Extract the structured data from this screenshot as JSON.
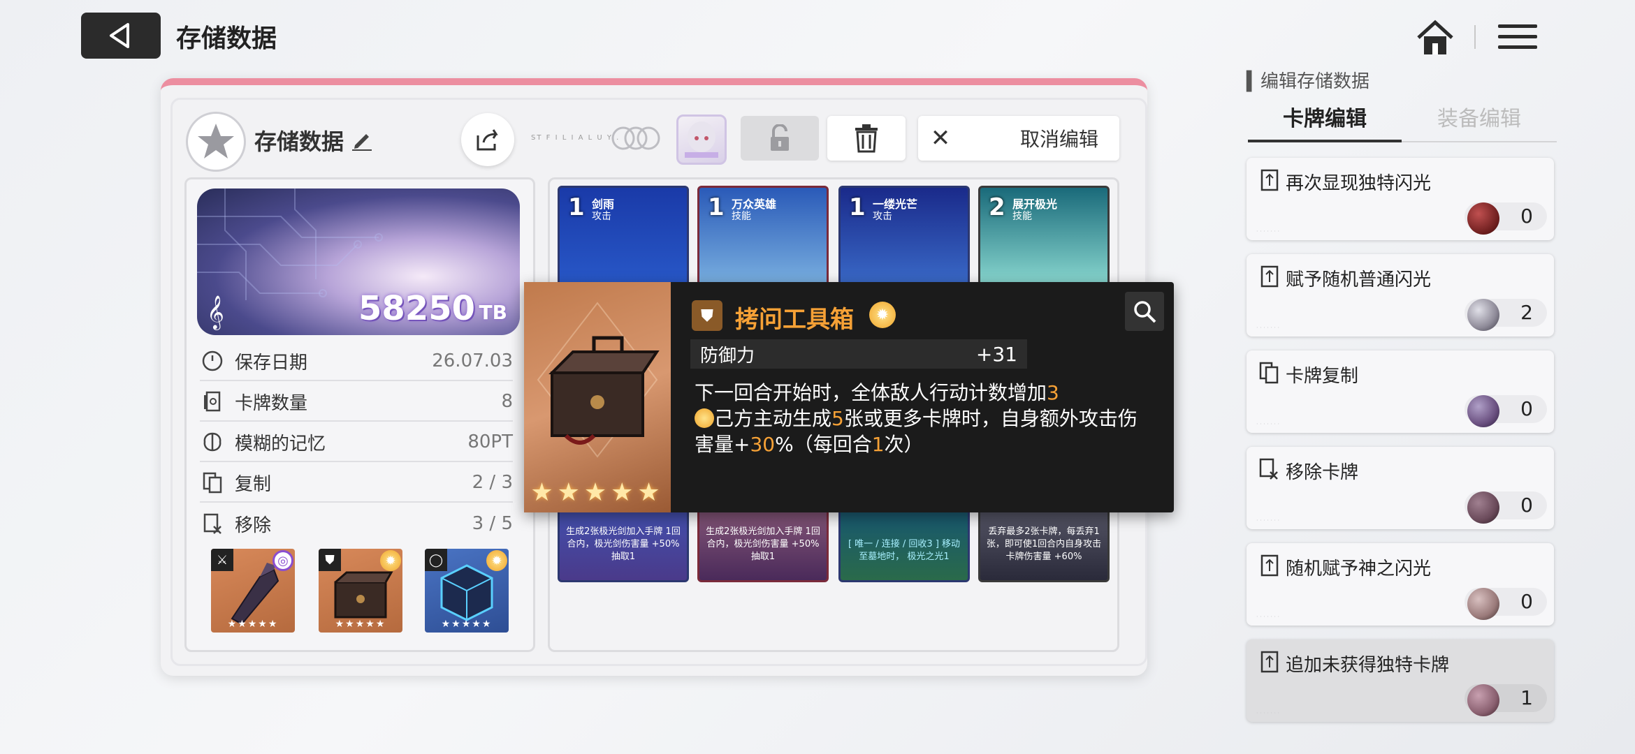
{
  "header": {
    "title": "存储数据"
  },
  "panel": {
    "data_name": "存储数据",
    "tiny_text": "ST F I L I A L U Y .",
    "cancel_label": "取消编辑"
  },
  "storage": {
    "value": "58250",
    "unit": "TB"
  },
  "info_rows": [
    {
      "icon": "clock-icon",
      "label": "保存日期",
      "value": "26.07.03"
    },
    {
      "icon": "card-count-icon",
      "label": "卡牌数量",
      "value": "8"
    },
    {
      "icon": "brain-icon",
      "label": "模糊的记忆",
      "value": "80PT"
    },
    {
      "icon": "copy-icon",
      "label": "复制",
      "value": "2 / 3"
    },
    {
      "icon": "remove-card-icon",
      "label": "移除",
      "value": "3 / 5"
    }
  ],
  "equipment": [
    {
      "stars": "★★★★★",
      "type": "weapon",
      "bg": "#c9784a"
    },
    {
      "stars": "★★★★★",
      "type": "armor",
      "bg": "#c9784a"
    },
    {
      "stars": "★★★★★",
      "type": "accessory",
      "bg": "#3a5ea8"
    }
  ],
  "cards": [
    {
      "cost": "1",
      "name": "剑雨",
      "type": "攻击",
      "desc": "生成2张极光剑加入手牌 1回合内，极光剑伤害量 +50% 抽取1"
    },
    {
      "cost": "1",
      "name": "万众英雄",
      "type": "技能",
      "desc": "生成2张极光剑加入手牌 1回合内，极光剑伤害量 +50% 抽取1"
    },
    {
      "cost": "1",
      "name": "一缕光芒",
      "type": "攻击",
      "desc": "[ 唯一 / 连接 / 回收3 ] 移动至墓地时， 极光之光1"
    },
    {
      "cost": "2",
      "name": "展开极光",
      "type": "技能",
      "desc": "丢弃最多2张卡牌，每丢弃1张，即可使1回合内自身攻击卡牌伤害量 +60%"
    }
  ],
  "tooltip": {
    "title": "拷问工具箱",
    "stat_label": "防御力",
    "stat_value": "+31",
    "stars": "★★★★★",
    "desc_1": "下一回合开始时，全体敌人行动计数增加",
    "desc_1_hl": "3",
    "desc_2a": "己方主动生成",
    "desc_2_hl1": "5",
    "desc_2b": "张或更多卡牌时，自身额外攻击伤害量+",
    "desc_2_hl2": "30",
    "desc_2c": "%（每回合",
    "desc_2_hl3": "1",
    "desc_2d": "次）"
  },
  "right_panel": {
    "title": "编辑存储数据",
    "tabs": [
      "卡牌编辑",
      "装备编辑"
    ],
    "options": [
      {
        "label": "再次显现独特闪光",
        "count": "0",
        "orb": "#6a1c1c"
      },
      {
        "label": "赋予随机普通闪光",
        "count": "2",
        "orb": "#8e8a98"
      },
      {
        "label": "卡牌复制",
        "count": "0",
        "orb": "#6a5080"
      },
      {
        "label": "移除卡牌",
        "count": "0",
        "orb": "#6a4a5a"
      },
      {
        "label": "随机赋予神之闪光",
        "count": "0",
        "orb": "#9a7a7a"
      },
      {
        "label": "追加未获得独特卡牌",
        "count": "1",
        "orb": "#8a6070"
      }
    ]
  }
}
